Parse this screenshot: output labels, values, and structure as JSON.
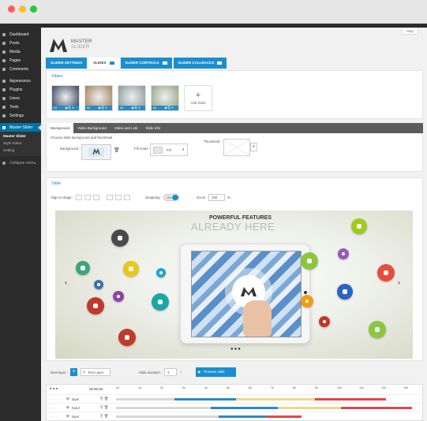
{
  "admin_menu": {
    "items": [
      {
        "label": "Dashboard",
        "icon": "dashboard-icon"
      },
      {
        "label": "Posts",
        "icon": "pin-icon"
      },
      {
        "label": "Media",
        "icon": "media-icon"
      },
      {
        "label": "Pages",
        "icon": "page-icon"
      },
      {
        "label": "Comments",
        "icon": "comment-icon"
      },
      {
        "label": "Appearance",
        "icon": "brush-icon"
      },
      {
        "label": "Plugins",
        "icon": "plug-icon"
      },
      {
        "label": "Users",
        "icon": "user-icon"
      },
      {
        "label": "Tools",
        "icon": "wrench-icon"
      },
      {
        "label": "Settings",
        "icon": "settings-icon"
      }
    ],
    "active": {
      "label": "Master Slider",
      "icon": "slider-icon"
    },
    "submenu": [
      "Master Slider",
      "Style Editor",
      "Setting"
    ],
    "collapse_label": "Collapse menu"
  },
  "help_label": "Help",
  "logo": {
    "line1": "MASTER",
    "line2": "SLIDER"
  },
  "tabs": [
    "SLIDER SETTINGS",
    "SLIDES",
    "SLIDER CONTROLS",
    "SLIDER CALLBACKS"
  ],
  "slides_panel": {
    "title": "Slides",
    "slides": [
      {
        "num": "#1",
        "color": "#4d5a70"
      },
      {
        "num": "#2",
        "color": "#a89170"
      },
      {
        "num": "#3",
        "color": "#96a2a5"
      },
      {
        "num": "#4",
        "color": "#9fae93"
      }
    ],
    "add_label": "Add Slide"
  },
  "subtabs": [
    "Background",
    "Video Background",
    "Video and Link",
    "Slide Info"
  ],
  "background": {
    "hint": "Choose slide background and thumbnail",
    "bg_label": "Background :",
    "fill_label": "Fill mode :",
    "fill_value": "Fill",
    "thumb_label": "Thumbnail :"
  },
  "slide_panel": {
    "title": "Slide",
    "align_label": "Align to stage :",
    "snapping_label": "Snapping :",
    "snapping_value": "ON",
    "zoom_label": "Zoom :",
    "zoom_value": "100",
    "zoom_unit": "%"
  },
  "stage": {
    "headline": "POWERFUL FEATURES",
    "subheadline": "ALREADY HERE"
  },
  "layer_bar": {
    "new_layer_label": "New layer :",
    "layer_type": "Text Layer",
    "duration_label": "Slide duration :",
    "duration_value": "3",
    "preview_label": "Preview slide"
  },
  "timeline": {
    "time": "00:00.00",
    "ticks": [
      "0s",
      "1s",
      "2s",
      "3s",
      "4s",
      "5s",
      "6s",
      "7s",
      "8s",
      "9s",
      "10s",
      "11s",
      "12s",
      "13s"
    ],
    "layers": [
      "layer",
      "hand",
      "layer"
    ]
  },
  "colors": {
    "accent": "#1a8ed1",
    "sidebar": "#2b2b2b",
    "menu_active": "#0074a2"
  }
}
